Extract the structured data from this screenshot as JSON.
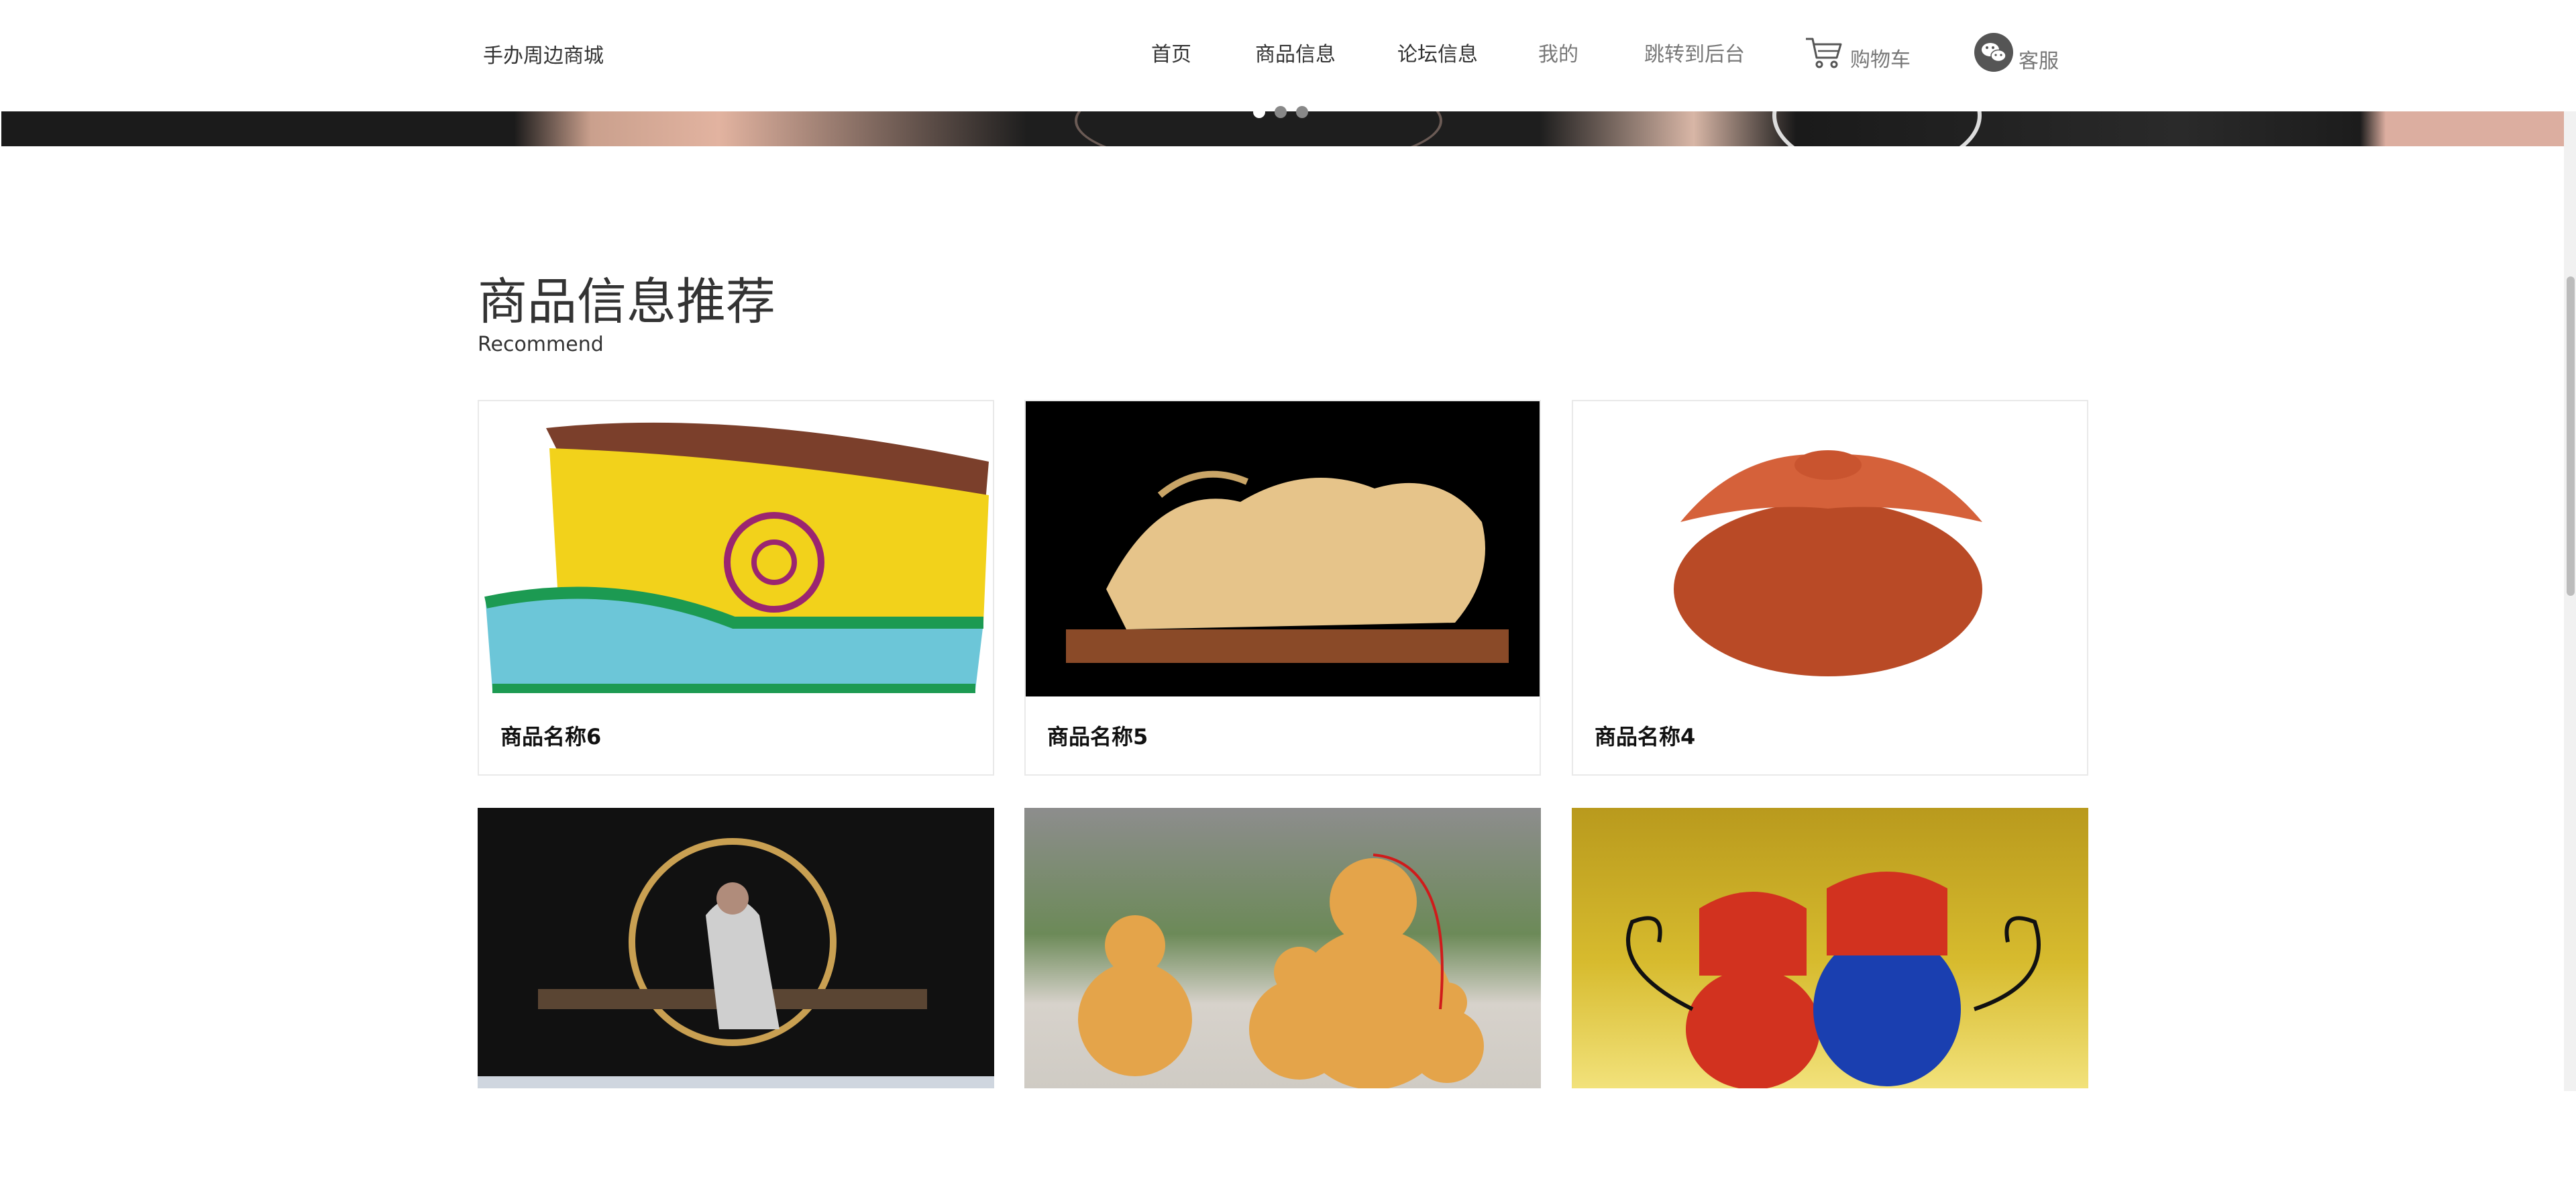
{
  "header": {
    "brand": "手办周边商城",
    "nav": {
      "home": "首页",
      "goods": "商品信息",
      "forum": "论坛信息",
      "mine": "我的",
      "admin": "跳转到后台"
    },
    "cart_label": "购物车",
    "service_label": "客服"
  },
  "banner": {
    "active_slide": 1,
    "slide_count": 3
  },
  "section": {
    "title": "商品信息推荐",
    "subtitle": "Recommend"
  },
  "products": [
    {
      "name": "商品名称6",
      "image": "mongolian-hat"
    },
    {
      "name": "商品名称5",
      "image": "carved-dragon"
    },
    {
      "name": "商品名称4",
      "image": "amber-pot"
    },
    {
      "name": "",
      "image": "incense-figure"
    },
    {
      "name": "",
      "image": "gourds"
    },
    {
      "name": "",
      "image": "tiger-figurines"
    }
  ],
  "colors": {
    "text": "#333333",
    "muted": "#777777",
    "border": "#e9e9e9"
  }
}
